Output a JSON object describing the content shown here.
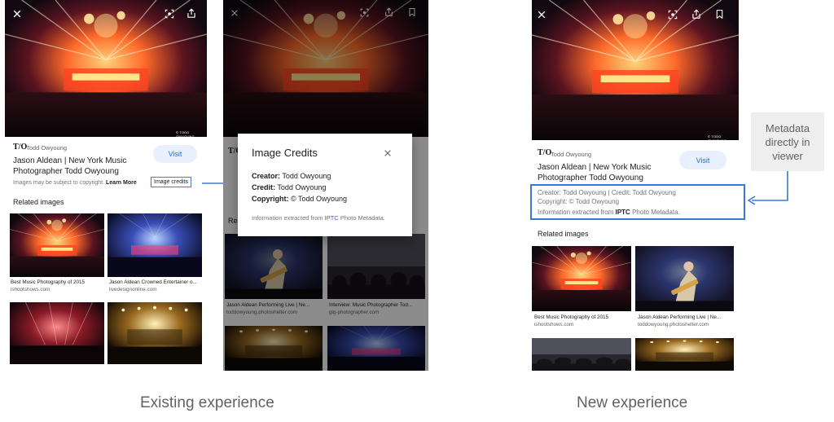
{
  "shared": {
    "source_name": "Todd Owyoung",
    "logo_text": "T/O",
    "watermark": "© TODD OWYOUNG",
    "title_line1": "Jason Aldean | New York Music",
    "title_line2": "Photographer Todd Owyoung",
    "visit_label": "Visit",
    "related_label": "Related images"
  },
  "existing": {
    "copyright_notice": "Images may be subject to copyright.",
    "learn_more": "Learn More",
    "image_credits_link": "Image credits",
    "related": [
      {
        "caption": "Best Music Photography of 2015",
        "source": "ishootshows.com"
      },
      {
        "caption": "Jason Aldean Crowned Entertainer o...",
        "source": "livedesignonline.com"
      }
    ],
    "caption": "Existing experience"
  },
  "dialog": {
    "title": "Image Credits",
    "creator_label": "Creator:",
    "creator_value": "Todd Owyoung",
    "credit_label": "Credit:",
    "credit_value": "Todd Owyoung",
    "copyright_label": "Copyright:",
    "copyright_value": "© Todd Owyoung",
    "note_prefix": "Information extracted from",
    "note_link": "IPTC",
    "note_suffix": "Photo Metadata.",
    "bg_related": [
      {
        "caption": "Jason Aldean Performing Live | Ne...",
        "source": "toddowyoung.photoshelter.com"
      },
      {
        "caption": "Interview: Music Photographer Tod...",
        "source": "gig-photographer.com"
      }
    ]
  },
  "new": {
    "meta_line1": "Creator: Todd Owyoung | Credit: Todd Owyoung",
    "meta_line2": "Copyright: © Todd Owyoung",
    "meta_note_prefix": "Information extracted from",
    "meta_note_bold": "IPTC",
    "meta_note_suffix": "Photo Metadata.",
    "related": [
      {
        "caption": "Best Music Photography of 2015",
        "source": "ishootshows.com"
      },
      {
        "caption": "Jason Aldean Performing Live | Ne...",
        "source": "toddowyoung.photoshelter.com"
      }
    ],
    "callout": "Metadata directly in viewer",
    "caption": "New experience"
  },
  "colors": {
    "accent": "#3a78d4",
    "visit_bg": "#e8f0fe",
    "visit_text": "#1a73e8",
    "callout_bg": "#eeeeee"
  }
}
